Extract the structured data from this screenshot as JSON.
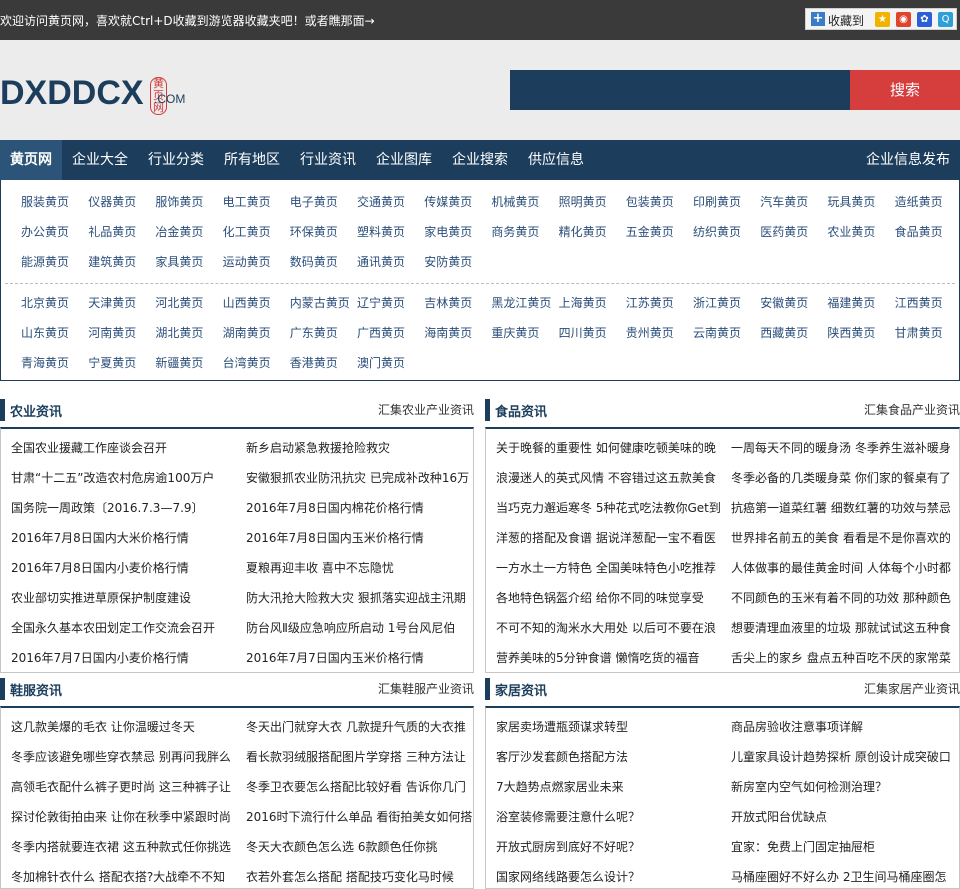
{
  "topbar": {
    "welcome": "欢迎访问黄页网，喜欢就Ctrl+D收藏到游览器收藏夹吧！或者瞧那面→",
    "bookmark_label": "收藏到"
  },
  "logo": {
    "text": "DXDDCX",
    "cn": "黄页网",
    "com": ".COM"
  },
  "search": {
    "button": "搜索",
    "placeholder": ""
  },
  "nav": {
    "items": [
      "黄页网",
      "企业大全",
      "行业分类",
      "所有地区",
      "行业资讯",
      "企业图库",
      "企业搜索",
      "供应信息"
    ],
    "right": "企业信息发布"
  },
  "categories": {
    "industry": [
      "服装黄页",
      "仪器黄页",
      "服饰黄页",
      "电工黄页",
      "电子黄页",
      "交通黄页",
      "传媒黄页",
      "机械黄页",
      "照明黄页",
      "包装黄页",
      "印刷黄页",
      "汽车黄页",
      "玩具黄页",
      "造纸黄页",
      "办公黄页",
      "礼品黄页",
      "冶金黄页",
      "化工黄页",
      "环保黄页",
      "塑料黄页",
      "家电黄页",
      "商务黄页",
      "精化黄页",
      "五金黄页",
      "纺织黄页",
      "医药黄页",
      "农业黄页",
      "食品黄页",
      "能源黄页",
      "建筑黄页",
      "家具黄页",
      "运动黄页",
      "数码黄页",
      "通讯黄页",
      "安防黄页"
    ],
    "region": [
      "北京黄页",
      "天津黄页",
      "河北黄页",
      "山西黄页",
      "内蒙古黄页",
      "辽宁黄页",
      "吉林黄页",
      "黑龙江黄页",
      "上海黄页",
      "江苏黄页",
      "浙江黄页",
      "安徽黄页",
      "福建黄页",
      "江西黄页",
      "山东黄页",
      "河南黄页",
      "湖北黄页",
      "湖南黄页",
      "广东黄页",
      "广西黄页",
      "海南黄页",
      "重庆黄页",
      "四川黄页",
      "贵州黄页",
      "云南黄页",
      "西藏黄页",
      "陕西黄页",
      "甘肃黄页",
      "青海黄页",
      "宁夏黄页",
      "新疆黄页",
      "台湾黄页",
      "香港黄页",
      "澳门黄页"
    ]
  },
  "sections": [
    {
      "title": "农业资讯",
      "more": "汇集农业产业资讯",
      "left": [
        "全国农业援藏工作座谈会召开",
        "甘肃“十二五”改造农村危房逾100万户",
        "国务院一周政策〔2016.7.3—7.9〕",
        "2016年7月8日国内大米价格行情",
        "2016年7月8日国内小麦价格行情",
        "农业部切实推进草原保护制度建设",
        "全国永久基本农田划定工作交流会召开",
        "2016年7月7日国内小麦价格行情"
      ],
      "right": [
        "新乡启动紧急救援抢险救灾",
        "安徽狠抓农业防汛抗灾 已完成补改种16万",
        "2016年7月8日国内棉花价格行情",
        "2016年7月8日国内玉米价格行情",
        "夏粮再迎丰收 喜中不忘隐忧",
        "防大汛抢大险救大灾 狠抓落实迎战主汛期",
        "防台风Ⅱ级应急响应所启动 1号台风尼伯",
        "2016年7月7日国内玉米价格行情"
      ]
    },
    {
      "title": "食品资讯",
      "more": "汇集食品产业资讯",
      "left": [
        "关于晚餐的重要性 如何健康吃顿美味的晚",
        "浪漫迷人的英式风情 不容错过这五款美食",
        "当巧克力邂逅寒冬 5种花式吃法教你Get到",
        "洋葱的搭配及食谱 据说洋葱配一宝不看医",
        "一方水土一方特色 全国美味特色小吃推荐",
        "各地特色锅盔介绍 给你不同的味觉享受",
        "不可不知的淘米水大用处 以后可不要在浪",
        "营养美味的5分钟食谱 懒惰吃货的福音"
      ],
      "right": [
        "一周每天不同的暖身汤 冬季养生滋补暖身",
        "冬季必备的几类暖身菜 你们家的餐桌有了",
        "抗癌第一道菜红薯 细数红薯的功效与禁忌",
        "世界排名前五的美食 看看是不是你喜欢的",
        "人体做事的最佳黄金时间 人体每个小时都",
        "不同颜色的玉米有着不同的功效 那种颜色",
        "想要清理血液里的垃圾 那就试试这五种食",
        "舌尖上的家乡 盘点五种百吃不厌的家常菜"
      ]
    },
    {
      "title": "鞋服资讯",
      "more": "汇集鞋服产业资讯",
      "left": [
        "这几款美爆的毛衣 让你温暖过冬天",
        "冬季应该避免哪些穿衣禁忌 别再问我胖么",
        "高领毛衣配什么裤子更时尚 这三种裤子让",
        "探讨伦敦街拍由来 让你在秋季中紧跟时尚",
        "冬季内搭就要连衣裙 这五种款式任你挑选",
        "冬加棉针衣什么 搭配衣搭?大战牵不不知"
      ],
      "right": [
        "冬天出门就穿大衣 几款提升气质的大衣推",
        "看长款羽绒服搭配图片学穿搭 三种方法让",
        "冬季卫衣要怎么搭配比较好看 告诉你几门",
        "2016时下流行什么单品 看街拍美女如何搭",
        "冬天大衣颜色怎么选 6款颜色任你挑",
        "衣若外套怎么搭配 搭配技巧变化马时候"
      ]
    },
    {
      "title": "家居资讯",
      "more": "汇集家居产业资讯",
      "left": [
        "家居卖场遭瓶颈谋求转型",
        "客厅沙发套颜色搭配方法",
        "7大趋势点燃家居业未来",
        "浴室装修需要注意什么呢？",
        "开放式厨房到底好不好呢？",
        "国家网络线路要怎么设计？"
      ],
      "right": [
        "商品房验收注意事项详解",
        "儿童家具设计趋势探析 原创设计成突破口",
        "新房室内空气如何检测治理？",
        "开放式阳台优缺点",
        "宜家：免费上门固定抽屉柜",
        "马桶座圈好不好么办 2卫生间马桶座圈怎"
      ]
    }
  ]
}
